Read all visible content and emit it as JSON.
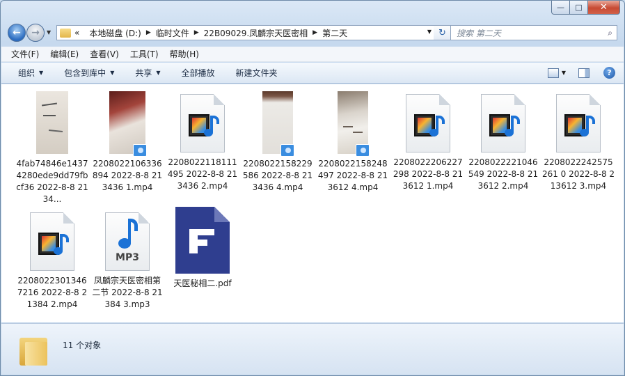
{
  "window": {
    "minimize_glyph": "—",
    "maximize_glyph": "□",
    "close_glyph": "✕"
  },
  "nav": {
    "back_glyph": "←",
    "forward_glyph": "→",
    "breadcrumb_overflow": "«",
    "breadcrumb": [
      "本地磁盘 (D:)",
      "临时文件",
      "22B09029.凤麟宗天医密相",
      "第二天"
    ],
    "search_placeholder": "搜索 第二天",
    "refresh_glyph": "↻"
  },
  "menubar": [
    "文件(F)",
    "编辑(E)",
    "查看(V)",
    "工具(T)",
    "帮助(H)"
  ],
  "commands": {
    "organize": "组织",
    "include_library": "包含到库中",
    "share": "共享",
    "play_all": "全部播放",
    "new_folder": "新建文件夹",
    "help_glyph": "?"
  },
  "files": [
    {
      "name": "4fab74846e14374280ede9dd79fbcf36 2022-8-8 2134...",
      "type": "image",
      "theme": "paper"
    },
    {
      "name": "2208022106336894 2022-8-8 213436 1.mp4",
      "type": "video-photo",
      "theme": "red"
    },
    {
      "name": "2208022118111495 2022-8-8 213436 2.mp4",
      "type": "video"
    },
    {
      "name": "2208022158229586 2022-8-8 213436 4.mp4",
      "type": "video-photo",
      "theme": "wall"
    },
    {
      "name": "2208022158248497 2022-8-8 213612 4.mp4",
      "type": "video-photo",
      "theme": "desk"
    },
    {
      "name": "2208022206227298 2022-8-8 213612 1.mp4",
      "type": "video"
    },
    {
      "name": "2208022221046549 2022-8-8 213612 2.mp4",
      "type": "video"
    },
    {
      "name": "2208022242575261 0 2022-8-8 213612 3.mp4",
      "type": "video"
    },
    {
      "name": "2208022301346 7216 2022-8-8 21384 2.mp4",
      "type": "video"
    },
    {
      "name": "凤麟宗天医密相第二节 2022-8-8 21384 3.mp3",
      "type": "audio",
      "badge": "MP3"
    },
    {
      "name": "天医秘相二.pdf",
      "type": "pdf"
    }
  ],
  "status": {
    "count_text": "11 个对象"
  }
}
